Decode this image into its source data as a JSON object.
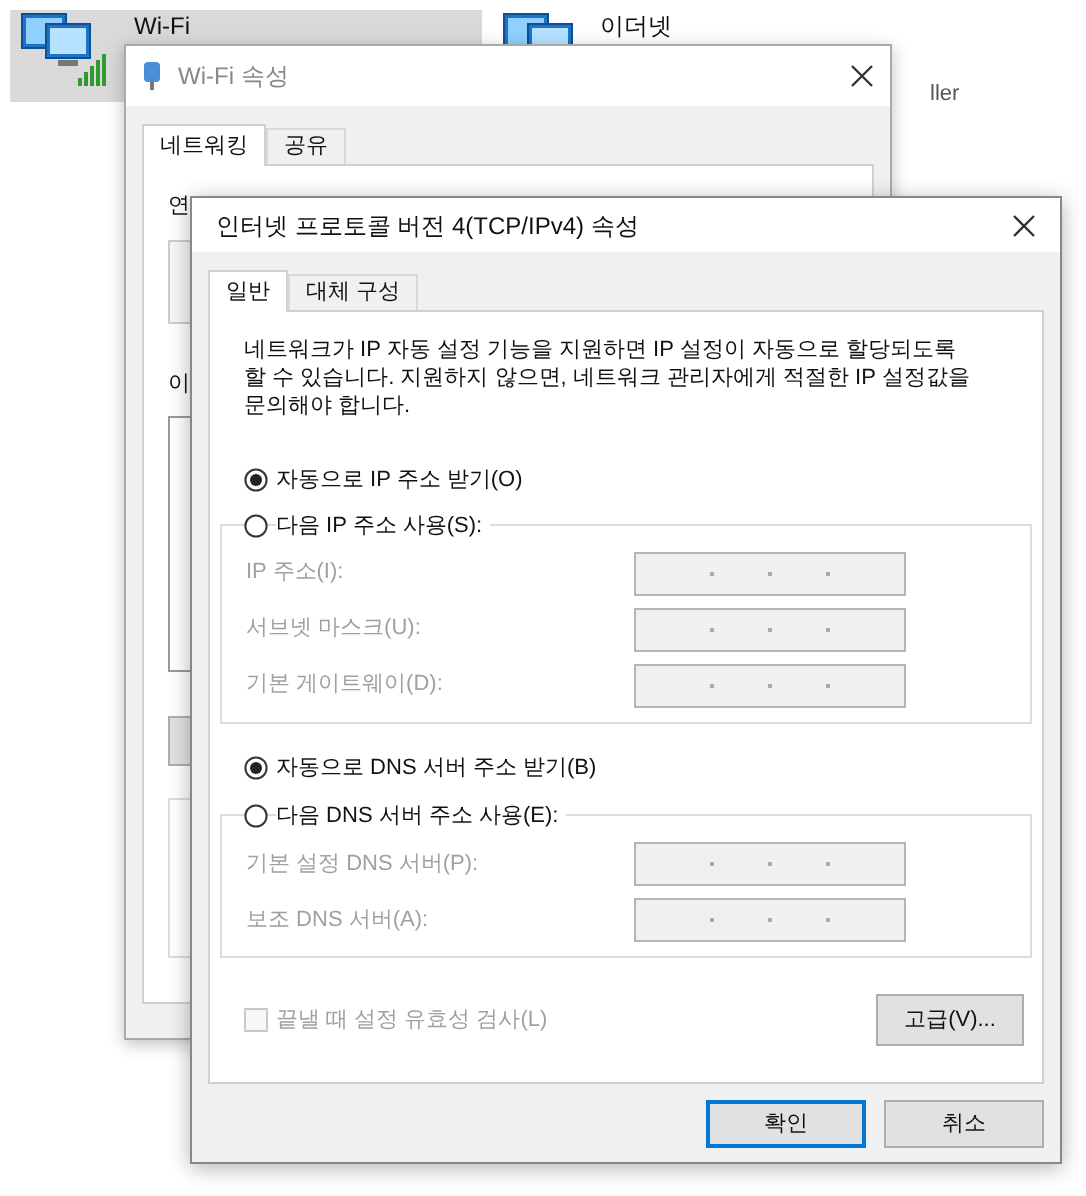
{
  "adapters": [
    {
      "kind": "wifi",
      "name": "Wi-Fi",
      "selected": true
    },
    {
      "kind": "ethernet",
      "name": "이더넷",
      "detail": "ller",
      "selected": false
    }
  ],
  "wifi_properties": {
    "title": "Wi-Fi 속성",
    "tabs": [
      {
        "label": "네트워킹",
        "selected": true
      },
      {
        "label": "공유",
        "selected": false
      }
    ],
    "device_label": "연",
    "items_label": "이"
  },
  "ipv4_properties": {
    "title": "인터넷 프로토콜 버전 4(TCP/IPv4) 속성",
    "tabs": [
      {
        "label": "일반",
        "selected": true
      },
      {
        "label": "대체 구성",
        "selected": false
      }
    ],
    "description": "네트워크가 IP 자동 설정 기능을 지원하면 IP 설정이 자동으로 할당되도록 할 수 있습니다. 지원하지 않으면, 네트워크 관리자에게 적절한 IP 설정값을 문의해야 합니다.",
    "ip_mode": [
      {
        "label": "자동으로 IP 주소 받기(O)",
        "selected": true
      },
      {
        "label": "다음 IP 주소 사용(S):",
        "selected": false
      }
    ],
    "ip_fields": [
      {
        "label": "IP 주소(I):",
        "disabled": true
      },
      {
        "label": "서브넷 마스크(U):",
        "disabled": true
      },
      {
        "label": "기본 게이트웨이(D):",
        "disabled": true
      }
    ],
    "dns_mode": [
      {
        "label": "자동으로 DNS 서버 주소 받기(B)",
        "selected": true
      },
      {
        "label": "다음 DNS 서버 주소 사용(E):",
        "selected": false
      }
    ],
    "dns_fields": [
      {
        "label": "기본 설정 DNS 서버(P):",
        "disabled": true
      },
      {
        "label": "보조 DNS 서버(A):",
        "disabled": true
      }
    ],
    "validate_on_exit": {
      "label": "끝낼 때 설정 유효성 검사(L)",
      "checked": false,
      "disabled": true
    },
    "advanced_button": "고급(V)...",
    "buttons": [
      {
        "label": "확인",
        "default": true
      },
      {
        "label": "취소",
        "default": false
      }
    ]
  }
}
